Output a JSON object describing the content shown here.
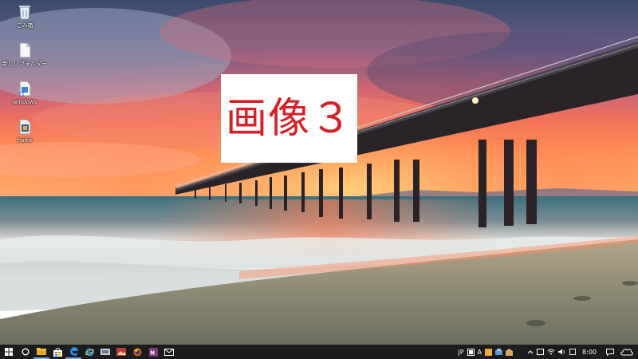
{
  "desktop": {
    "icons": [
      {
        "label": "ごみ箱",
        "icon": "recycle-bin-icon"
      },
      {
        "label": "新しいフォルダー",
        "icon": "folder-icon"
      },
      {
        "label": "windows",
        "icon": "shortcut-icon"
      },
      {
        "label": "haike",
        "icon": "file-icon"
      }
    ]
  },
  "caption": {
    "text": "画像３"
  },
  "taskbar": {
    "apps": [
      {
        "name": "start",
        "icon": "windows-logo-icon"
      },
      {
        "name": "cortana",
        "icon": "cortana-circle-icon"
      },
      {
        "name": "file-explorer",
        "icon": "folder-icon"
      },
      {
        "name": "store",
        "icon": "store-bag-icon"
      },
      {
        "name": "edge",
        "icon": "edge-icon"
      },
      {
        "name": "internet-explorer",
        "icon": "ie-icon"
      },
      {
        "name": "app-generic",
        "icon": "app-icon"
      },
      {
        "name": "app-picture",
        "icon": "picture-icon"
      },
      {
        "name": "firefox",
        "icon": "firefox-icon"
      },
      {
        "name": "onenote",
        "icon": "onenote-icon"
      },
      {
        "name": "mail",
        "icon": "mail-icon"
      }
    ],
    "tray": {
      "ime_mode": "JP",
      "ime_letter": "A",
      "clock": "8:00"
    },
    "colors": {
      "bar": "#1c1c1e",
      "accent": "#7aa7d6"
    }
  }
}
